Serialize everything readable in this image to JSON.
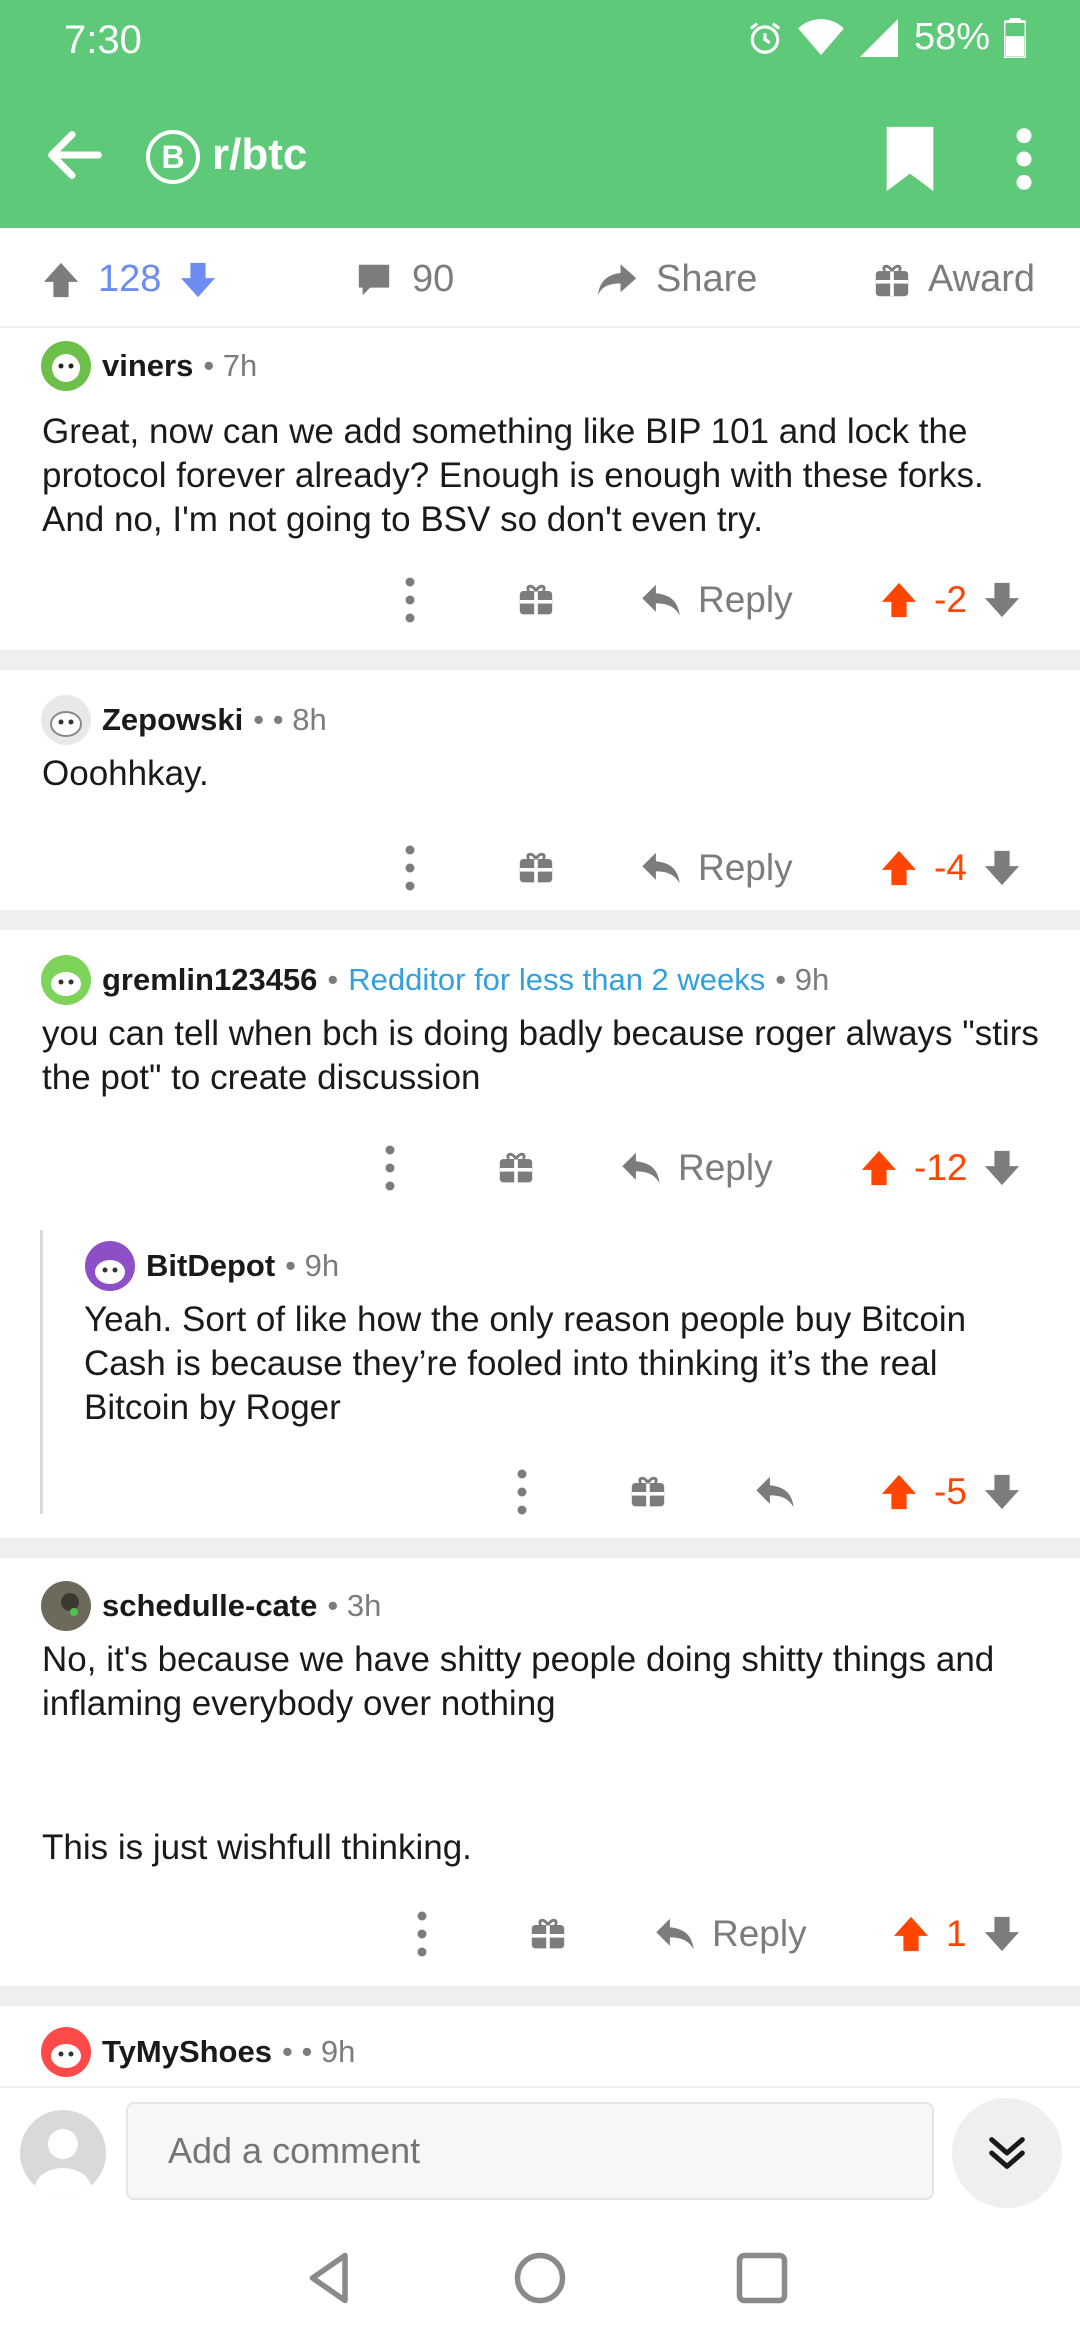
{
  "status": {
    "time": "7:30",
    "battery": "58%"
  },
  "header": {
    "subreddit": "r/btc",
    "badge": "B",
    "accent": "#5ec978"
  },
  "post_actions": {
    "score": "128",
    "comments": "90",
    "share_label": "Share",
    "award_label": "Award"
  },
  "comments": [
    {
      "user": "viners",
      "meta": "• 7h",
      "body": "Great, now can we add something like BIP 101 and lock the protocol forever already? Enough is enough with these forks. And no, I'm not going to BSV so don't even try.",
      "reply_label": "Reply",
      "score": "-2"
    },
    {
      "user": "Zepowski",
      "meta": "•  • 8h",
      "body": "Ooohhkay.",
      "reply_label": "Reply",
      "score": "-4"
    },
    {
      "user": "gremlin123456",
      "sep": "•",
      "flair": "Redditor for less than 2 weeks",
      "meta": "• 9h",
      "body": "you can tell when bch is doing badly because roger always \"stirs the pot\" to create discussion",
      "reply_label": "Reply",
      "score": "-12"
    },
    {
      "user": "BitDepot",
      "meta": "• 9h",
      "body": "Yeah. Sort of like how the only reason people buy Bitcoin Cash is because they’re fooled into thinking it’s the real Bitcoin by Roger",
      "score": "-5"
    },
    {
      "user": "schedulle-cate",
      "meta": "• 3h",
      "body": "No, it's because we have shitty people doing shitty things and inflaming everybody over nothing",
      "body2": "This is just wishfull thinking.",
      "reply_label": "Reply",
      "score": "1"
    },
    {
      "user": "TyMyShoes",
      "meta": "•  • 9h"
    }
  ],
  "composer": {
    "placeholder": "Add a comment"
  },
  "icons": [
    "back-arrow-icon",
    "bitcoin-icon",
    "bookmark-icon",
    "more-vertical-icon",
    "upvote-icon",
    "downvote-icon",
    "comment-icon",
    "share-icon",
    "gift-icon",
    "reply-icon",
    "double-chevron-down-icon",
    "nav-back-icon",
    "nav-home-icon",
    "nav-recents-icon"
  ],
  "colors": {
    "upvote_active": "#ff4500",
    "score_blue": "#6d8cf2",
    "flair": "#33a0dc"
  }
}
